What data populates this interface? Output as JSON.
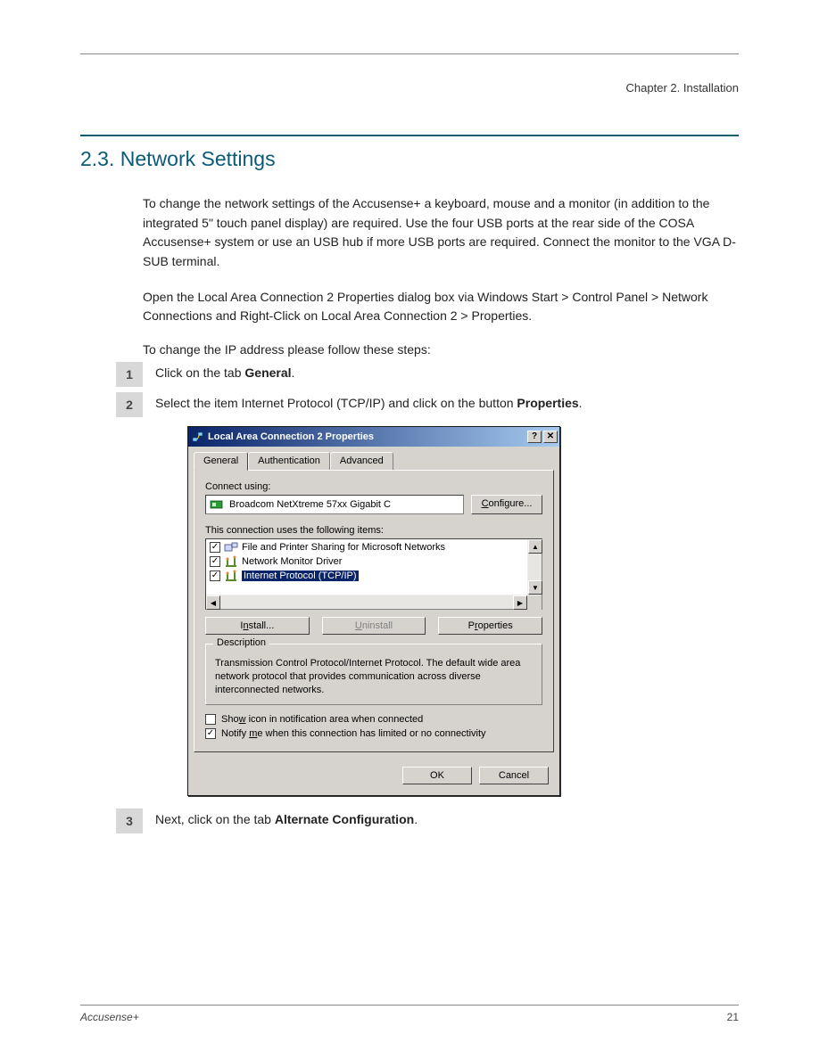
{
  "header": {
    "chapter": "Chapter 2. Installation"
  },
  "section_title": "2.3. Network Settings",
  "intro_p1": "To change the network settings of the Accusense+ a keyboard, mouse and a monitor (in addition to the integrated 5\" touch panel display) are required. Use the four USB ports at the rear side of the COSA Accusense+ system or use an USB hub if more USB ports are required. Connect the monitor to the VGA D-SUB terminal.",
  "intro_p2": "Open the Local Area Connection 2 Properties dialog box via Windows Start > Control Panel > Network Connections and Right-Click on Local Area Connection 2 > Properties.",
  "steps_intro": "To change the IP address please follow these steps:",
  "steps": {
    "s1": {
      "num": "1",
      "before": "Click on the tab ",
      "bold": "General",
      "after": "."
    },
    "s2": {
      "num": "2",
      "before": "Select the item Internet Protocol (TCP/IP) and click on the button ",
      "bold": "Properties",
      "after": "."
    },
    "s3": {
      "num": "3",
      "before": "Next, click on the tab ",
      "bold": "Alternate Configuration",
      "after": "."
    }
  },
  "dialog": {
    "title": "Local Area Connection 2 Properties",
    "help_glyph": "?",
    "close_glyph": "✕",
    "tabs": {
      "general": "General",
      "authentication": "Authentication",
      "advanced": "Advanced"
    },
    "connect_using_label": "Connect using:",
    "adapter_name": "Broadcom NetXtreme 57xx Gigabit C",
    "configure_label": "Configure...",
    "items_label": "This connection uses the following items:",
    "items": {
      "file_printer": "File and Printer Sharing for Microsoft Networks",
      "net_monitor": "Network Monitor Driver",
      "tcpip": "Internet Protocol (TCP/IP)"
    },
    "install_btn": "Install...",
    "uninstall_btn": "Uninstall",
    "properties_btn": "Properties",
    "description_label": "Description",
    "description_text": "Transmission Control Protocol/Internet Protocol. The default wide area network protocol that provides communication across diverse interconnected networks.",
    "show_icon_label": "Show icon in notification area when connected",
    "notify_label": "Notify me when this connection has limited or no connectivity",
    "ok_btn": "OK",
    "cancel_btn": "Cancel",
    "check_glyph": "✓",
    "up_glyph": "▲",
    "down_glyph": "▼",
    "left_glyph": "◀",
    "right_glyph": "▶"
  },
  "footer": {
    "product": "Accusense+",
    "page": "21"
  }
}
